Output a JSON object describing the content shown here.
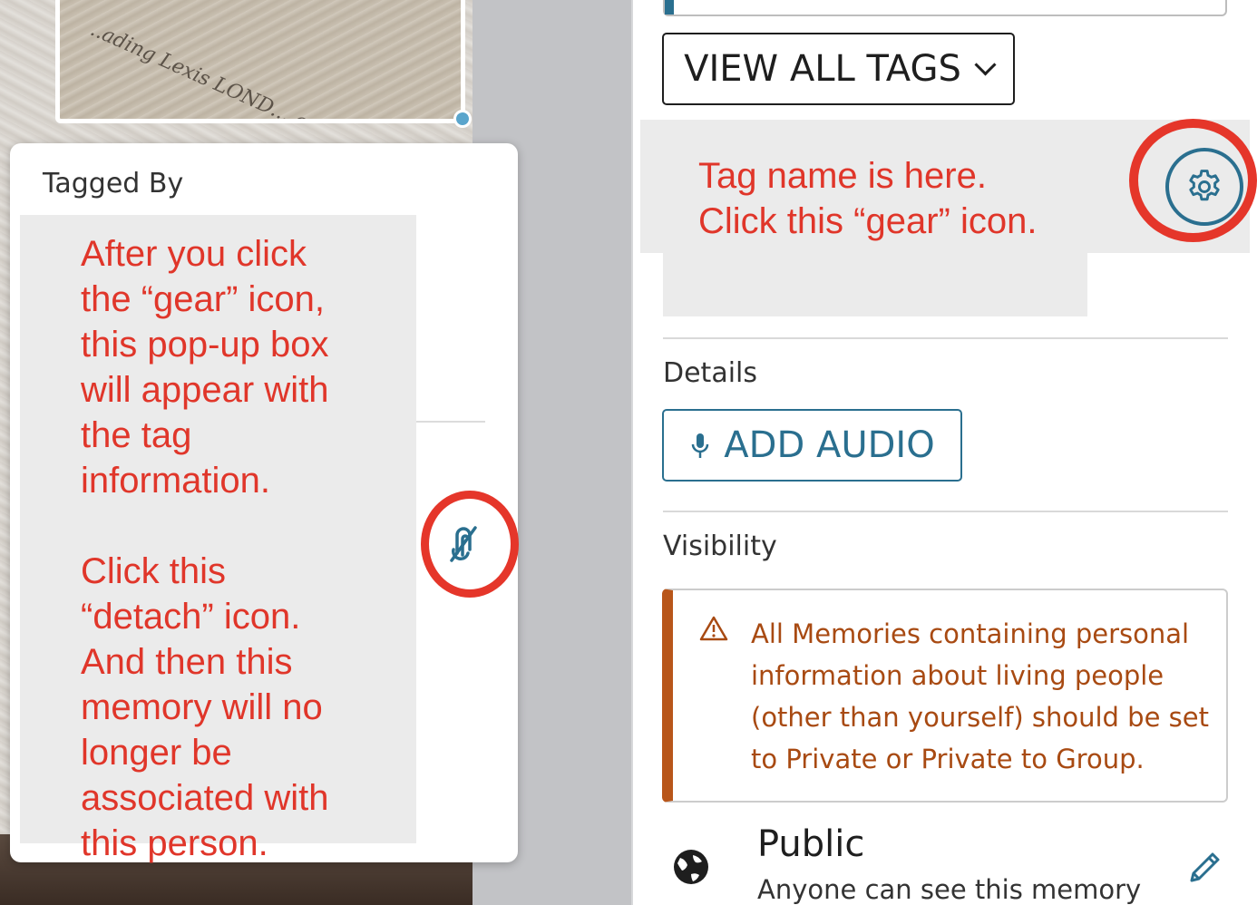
{
  "photo": {
    "crop_text": "..ading Lexis LOND... and Wizardry"
  },
  "tag_popup": {
    "title": "Tagged By",
    "annotation": "After you click\nthe “gear” icon,\nthis pop-up box\nwill appear with\nthe tag\ninformation.\n\nClick this\n“detach” icon.\nAnd then this\nmemory will no\nlonger be\nassociated with\nthis person.",
    "detach_icon": "detach-icon"
  },
  "tags": {
    "view_all_label": "VIEW ALL TAGS",
    "annotation": "Tag name is here.\nClick this “gear” icon.",
    "gear_icon": "gear-icon"
  },
  "details": {
    "label": "Details",
    "add_audio_label": "ADD AUDIO"
  },
  "visibility": {
    "label": "Visibility",
    "warning": "All Memories containing personal information about living people (other than yourself) should be set to Private or Private to Group.",
    "option_title": "Public",
    "option_desc": "Anyone can see this memory"
  },
  "colors": {
    "annotation_red": "#e0362a",
    "accent_blue": "#2a6f8f",
    "warning_orange": "#b8561a"
  }
}
